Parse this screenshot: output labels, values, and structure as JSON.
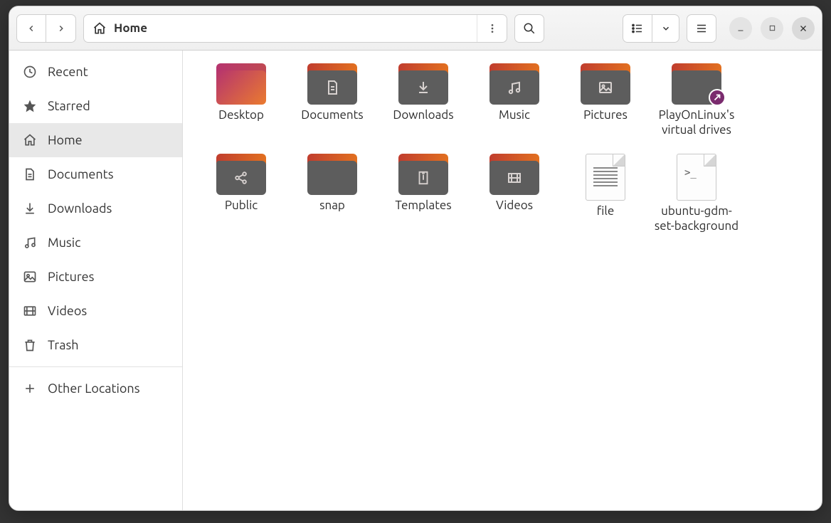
{
  "path": {
    "label": "Home"
  },
  "sidebar": {
    "items": [
      {
        "label": "Recent",
        "icon": "clock"
      },
      {
        "label": "Starred",
        "icon": "star"
      },
      {
        "label": "Home",
        "icon": "home",
        "active": true
      },
      {
        "label": "Documents",
        "icon": "doc"
      },
      {
        "label": "Downloads",
        "icon": "download"
      },
      {
        "label": "Music",
        "icon": "music"
      },
      {
        "label": "Pictures",
        "icon": "picture"
      },
      {
        "label": "Videos",
        "icon": "video"
      },
      {
        "label": "Trash",
        "icon": "trash"
      }
    ],
    "other_locations": "Other Locations"
  },
  "items": [
    {
      "label": "Desktop",
      "type": "folder",
      "variant": "desktop"
    },
    {
      "label": "Documents",
      "type": "folder",
      "glyph": "doc"
    },
    {
      "label": "Downloads",
      "type": "folder",
      "glyph": "download"
    },
    {
      "label": "Music",
      "type": "folder",
      "glyph": "music"
    },
    {
      "label": "Pictures",
      "type": "folder",
      "glyph": "picture"
    },
    {
      "label": "PlayOnLinux's virtual drives",
      "type": "folder",
      "link": true
    },
    {
      "label": "Public",
      "type": "folder",
      "glyph": "share"
    },
    {
      "label": "snap",
      "type": "folder"
    },
    {
      "label": "Templates",
      "type": "folder",
      "glyph": "template"
    },
    {
      "label": "Videos",
      "type": "folder",
      "glyph": "video"
    },
    {
      "label": "file",
      "type": "file-text"
    },
    {
      "label": "ubuntu-gdm-set-background",
      "type": "file-script"
    }
  ]
}
